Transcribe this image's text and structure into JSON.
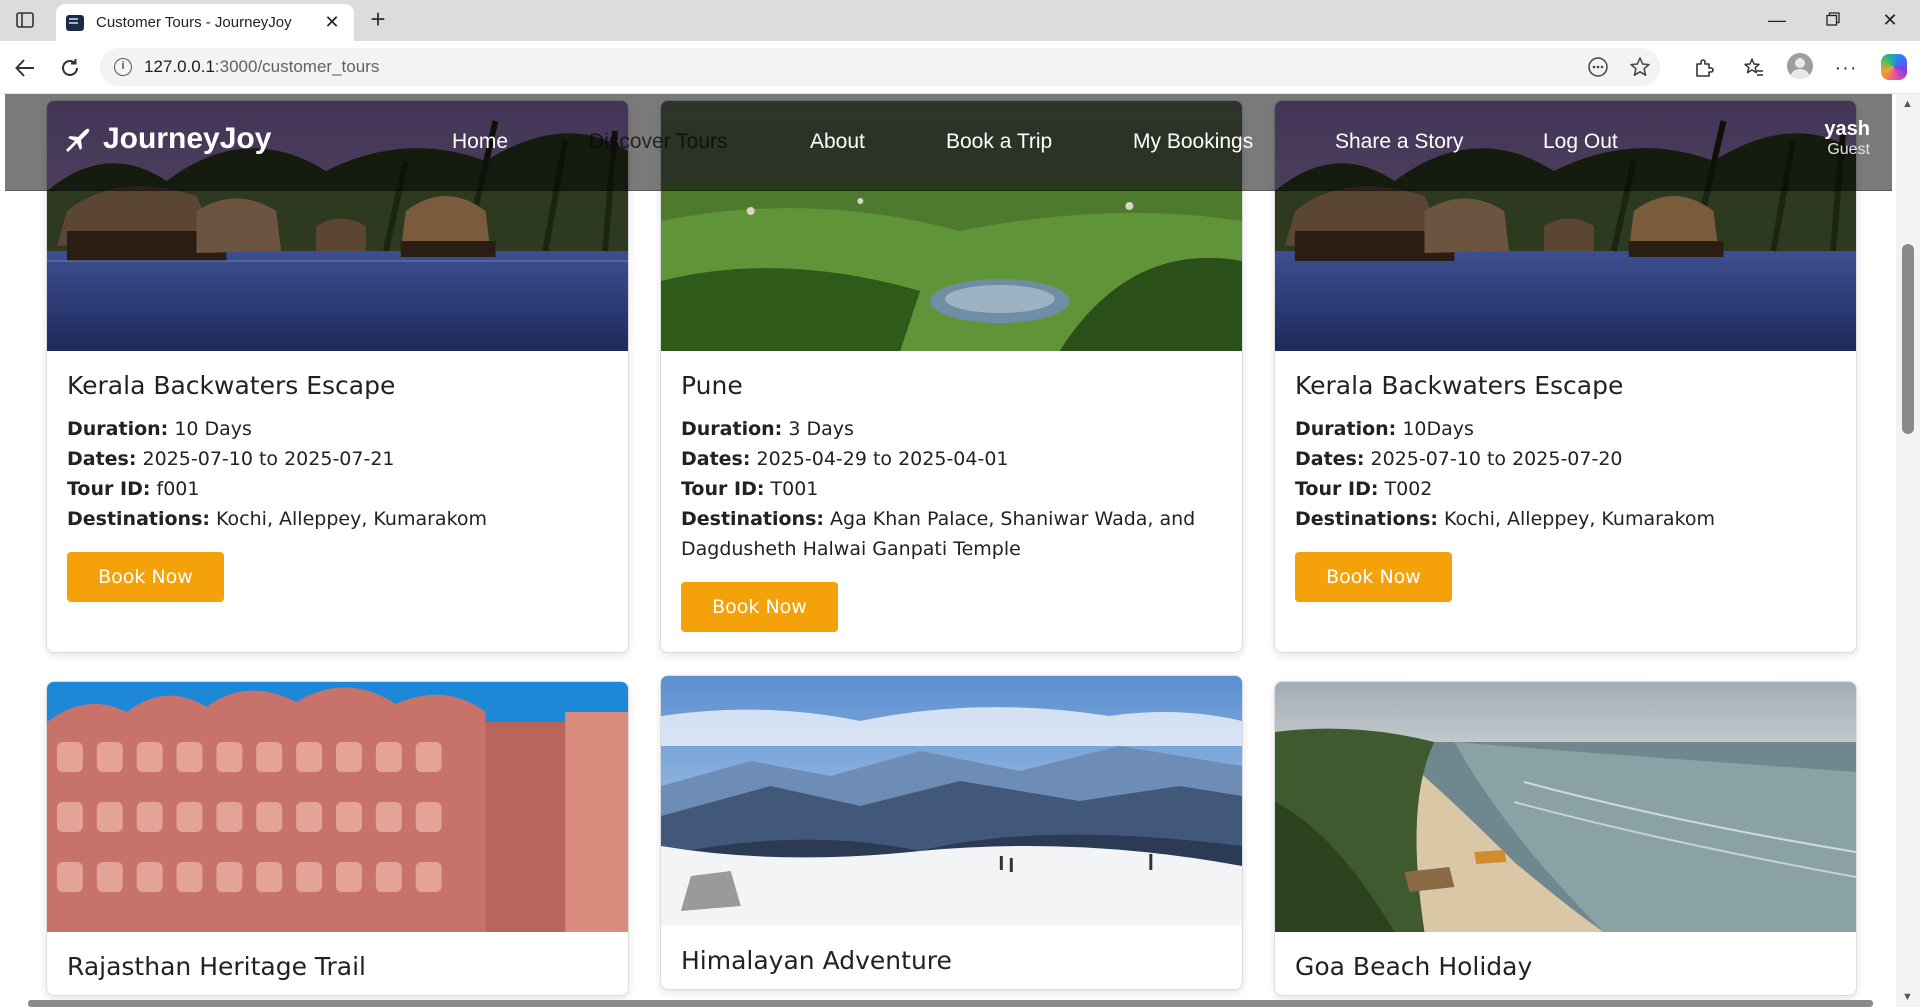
{
  "browser": {
    "tab_title": "Customer Tours - JourneyJoy",
    "url_host": "127.0.0.1",
    "url_path": ":3000/customer_tours"
  },
  "navbar": {
    "brand": "JourneyJoy",
    "links": [
      "Home",
      "Discover Tours",
      "About",
      "Book a Trip",
      "My Bookings",
      "Share a Story",
      "Log Out"
    ],
    "user_name": "yash",
    "user_role": "Guest"
  },
  "labels": {
    "duration": "Duration:",
    "dates": "Dates:",
    "tour_id": "Tour ID:",
    "destinations": "Destinations:",
    "book_now": "Book Now"
  },
  "tours": [
    {
      "title": "Kerala Backwaters Escape",
      "duration": "10 Days",
      "dates": "2025-07-10 to 2025-07-21",
      "tour_id": "f001",
      "destinations": "Kochi, Alleppey, Kumarakom",
      "image": "backwaters"
    },
    {
      "title": "Pune",
      "duration": "3 Days",
      "dates": "2025-04-29 to 2025-04-01",
      "tour_id": "T001",
      "destinations": "Aga Khan Palace, Shaniwar Wada, and Dagdusheth Halwai Ganpati Temple",
      "image": "green-valley"
    },
    {
      "title": "Kerala Backwaters Escape",
      "duration": "10Days",
      "dates": "2025-07-10 to 2025-07-20",
      "tour_id": "T002",
      "destinations": "Kochi, Alleppey, Kumarakom",
      "image": "backwaters"
    },
    {
      "title": "Rajasthan Heritage Trail",
      "image": "palace"
    },
    {
      "title": "Himalayan Adventure",
      "image": "snow-mountains"
    },
    {
      "title": "Goa Beach Holiday",
      "image": "beach"
    }
  ],
  "colors": {
    "accent": "#f5a20a",
    "navbar_overlay": "rgba(0,0,0,0.52)"
  }
}
